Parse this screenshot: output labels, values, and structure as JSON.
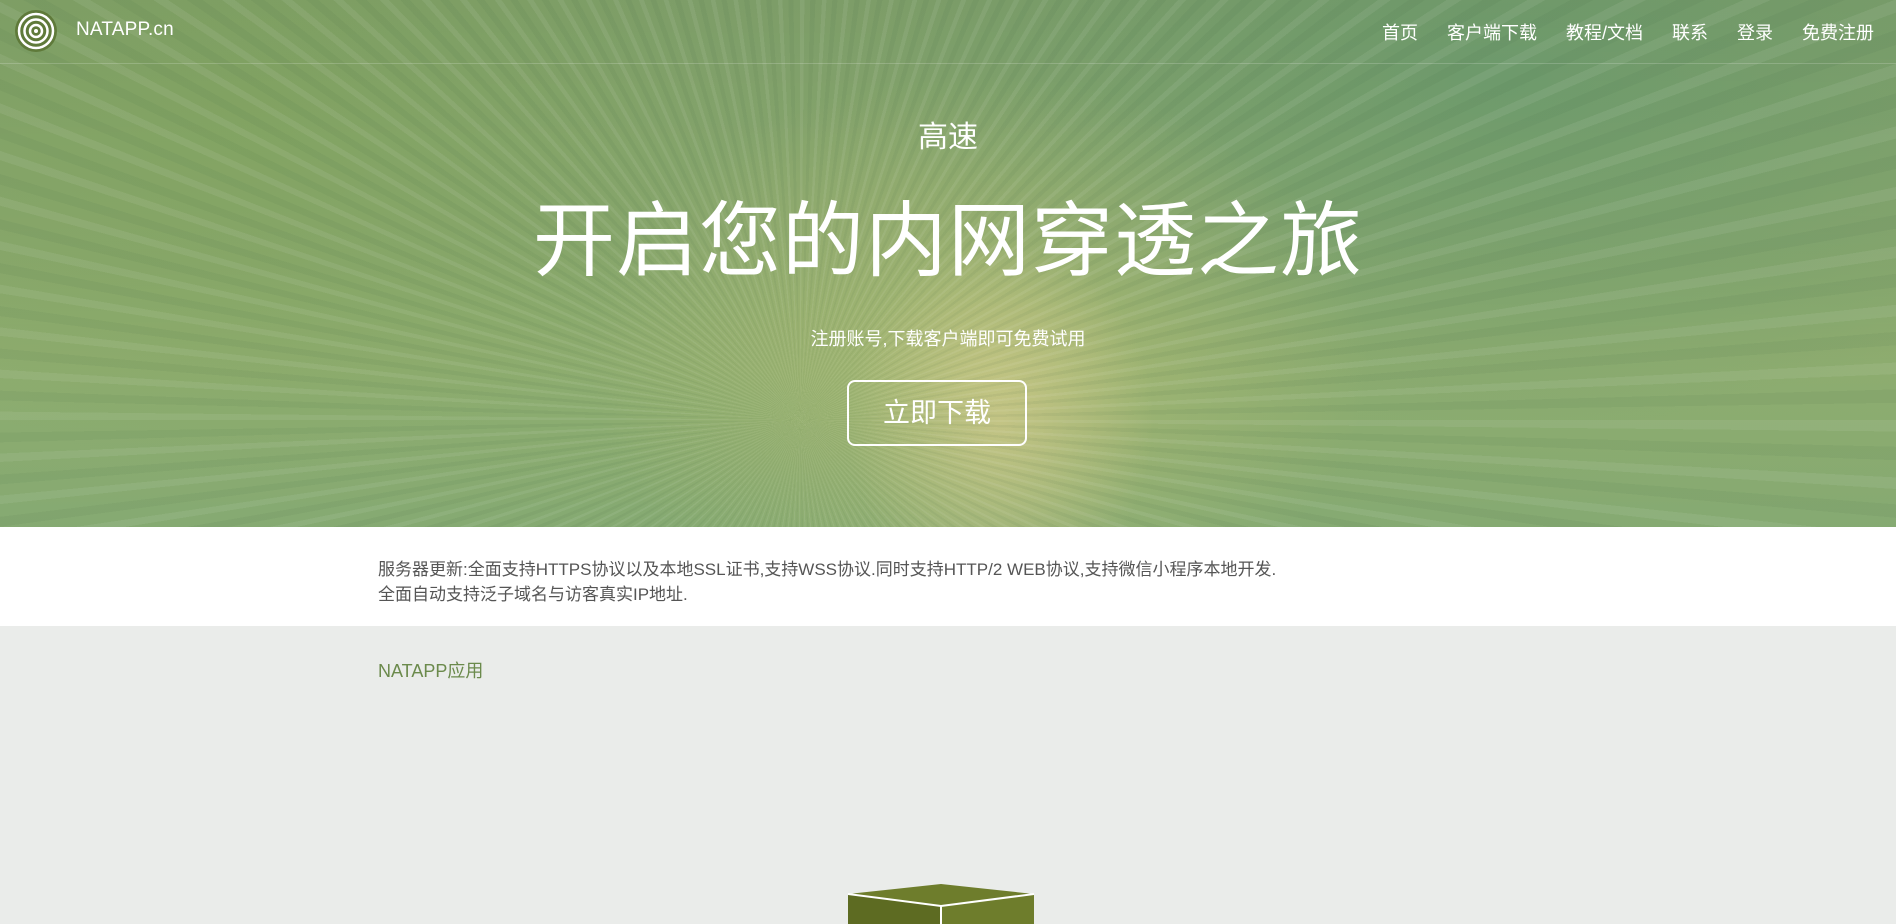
{
  "nav": {
    "brand": "NATAPP.cn",
    "links": [
      {
        "label": "首页"
      },
      {
        "label": "客户端下载"
      },
      {
        "label": "教程/文档"
      },
      {
        "label": "联系"
      },
      {
        "label": "登录"
      },
      {
        "label": "免费注册"
      }
    ]
  },
  "hero": {
    "subtitle": "高速",
    "title": "开启您的内网穿透之旅",
    "description": "注册账号,下载客户端即可免费试用",
    "cta_label": "立即下载"
  },
  "notice": {
    "line1": "服务器更新:全面支持HTTPS协议以及本地SSL证书,支持WSS协议.同时支持HTTP/2 WEB协议,支持微信小程序本地开发.",
    "line2": "全面自动支持泛子域名与访客真实IP地址."
  },
  "apps": {
    "heading": "NATAPP应用",
    "icon": "box-icon"
  },
  "colors": {
    "accent_green": "#6b8a4c",
    "box_green": "#6e7d2c",
    "notice_text": "#555555",
    "section_bg": "#eaecea"
  }
}
